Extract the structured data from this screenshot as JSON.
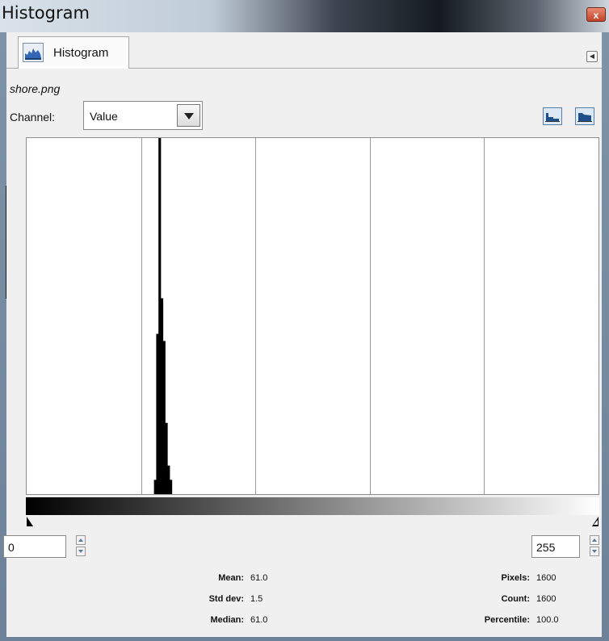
{
  "window": {
    "title": "Histogram",
    "close_glyph": "x"
  },
  "tab": {
    "label": "Histogram",
    "icon": "histogram-icon"
  },
  "image_name": "shore.png",
  "channel": {
    "label": "Channel:",
    "value": "Value"
  },
  "scale_buttons": [
    "linear-histogram-icon",
    "logarithmic-histogram-icon"
  ],
  "range": {
    "low": "0",
    "high": "255"
  },
  "stats": {
    "mean_label": "Mean:",
    "mean": "61.0",
    "stddev_label": "Std dev:",
    "stddev": "1.5",
    "median_label": "Median:",
    "median": "61.0",
    "pixels_label": "Pixels:",
    "pixels": "1600",
    "count_label": "Count:",
    "count": "1600",
    "percentile_label": "Percentile:",
    "percentile": "100.0"
  },
  "chart_data": {
    "type": "bar",
    "xlim": [
      0,
      255
    ],
    "ylim": [
      0,
      1
    ],
    "grid": true,
    "x": [
      57,
      58,
      59,
      60,
      61,
      62,
      63,
      64
    ],
    "values": [
      0.04,
      0.45,
      1.0,
      0.55,
      0.43,
      0.2,
      0.08,
      0.04
    ]
  }
}
